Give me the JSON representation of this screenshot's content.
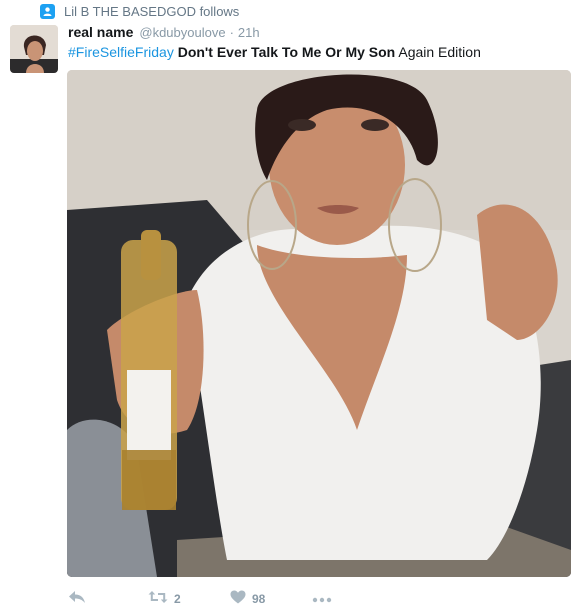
{
  "social_context": {
    "text": "Lil B THE BASEDGOD follows",
    "icon": "person-icon"
  },
  "tweet": {
    "fullname": "real name",
    "username": "@kdubyoulove",
    "separator": "·",
    "time": "21h",
    "hashtag": "#FireSelfieFriday",
    "bold_text": "Don't Ever Talk To Me Or My Son",
    "rest_text": "Again Edition"
  },
  "actions": {
    "reply": {
      "icon": "reply-icon"
    },
    "retweet": {
      "icon": "retweet-icon",
      "count": "2"
    },
    "like": {
      "icon": "heart-icon",
      "count": "98"
    },
    "more": {
      "icon": "more-icon"
    }
  },
  "colors": {
    "link": "#1b95e0",
    "meta": "#8899a6",
    "accent": "#1da1f2"
  }
}
